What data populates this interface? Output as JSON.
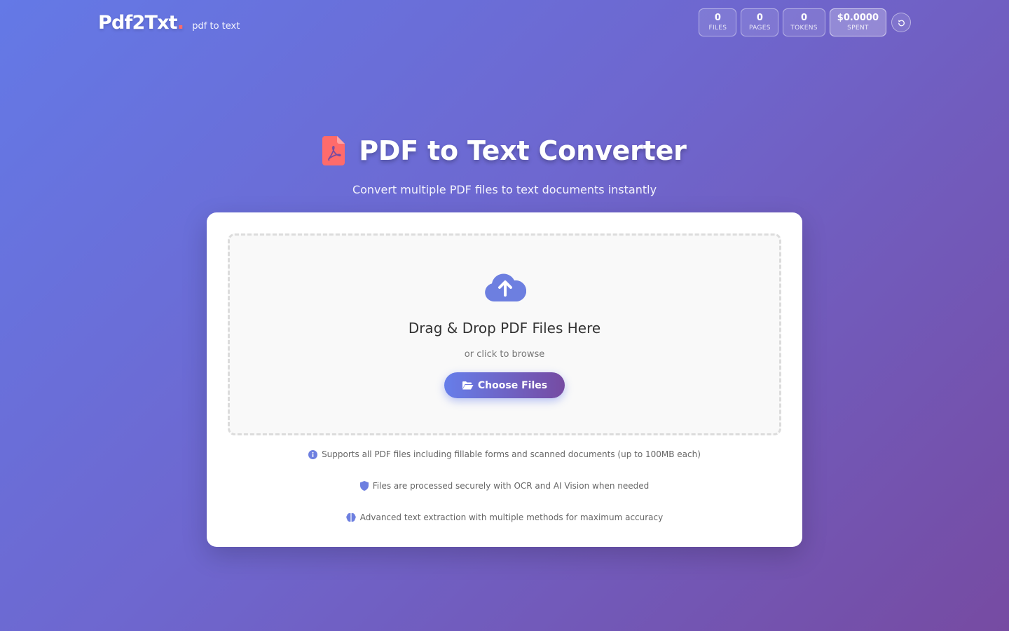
{
  "header": {
    "logo_text": "Pdf2Txt",
    "logo_dot": ".",
    "tagline": "pdf to text",
    "stats": [
      {
        "value": "0",
        "label": "FILES"
      },
      {
        "value": "0",
        "label": "PAGES"
      },
      {
        "value": "0",
        "label": "TOKENS"
      },
      {
        "value": "$0.0000",
        "label": "SPENT"
      }
    ],
    "reset_icon": "reset-icon"
  },
  "hero": {
    "title": "PDF to Text Converter",
    "subtitle": "Convert multiple PDF files to text documents instantly",
    "icon": "file-pdf-icon"
  },
  "dropzone": {
    "icon": "cloud-upload-icon",
    "title": "Drag & Drop PDF Files Here",
    "subtitle": "or click to browse",
    "button_label": "Choose Files",
    "button_icon": "folder-open-icon"
  },
  "info": [
    {
      "icon": "info-circle-icon",
      "text": "Supports all PDF files including fillable forms and scanned documents (up to 100MB each)"
    },
    {
      "icon": "shield-icon",
      "text": "Files are processed securely with OCR and AI Vision when needed"
    },
    {
      "icon": "brain-icon",
      "text": "Advanced text extraction with multiple methods for maximum accuracy"
    }
  ],
  "colors": {
    "accent": "#667eea",
    "accent_end": "#764ba2",
    "pdf_red": "#ff6b6b"
  }
}
